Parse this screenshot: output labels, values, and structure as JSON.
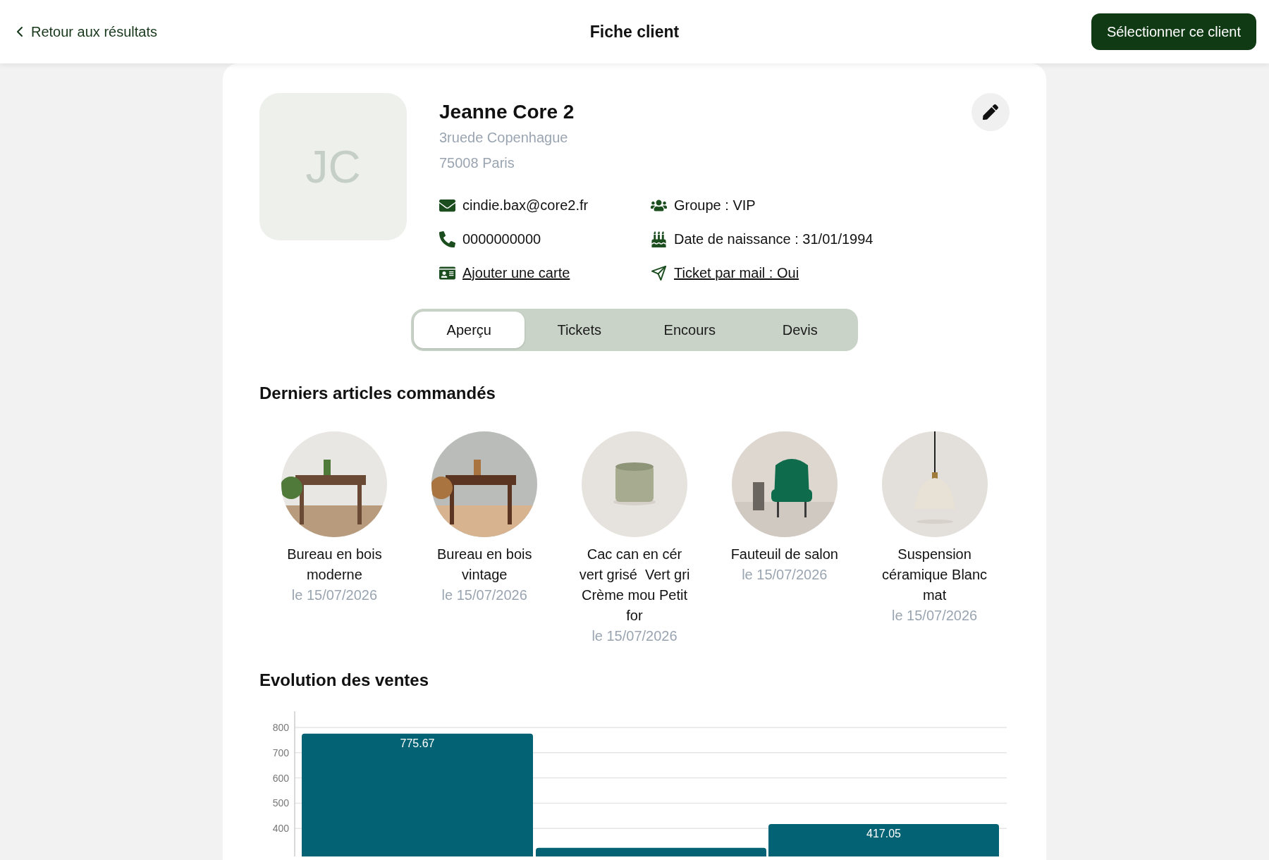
{
  "header": {
    "back_link": "Retour aux résultats",
    "title": "Fiche client",
    "action_button": "Sélectionner ce client"
  },
  "client": {
    "initials": "JC",
    "name": "Jeanne Core 2",
    "address_lines": [
      "3ruede Copenhague",
      "75008 Paris"
    ],
    "details": [
      {
        "kind": "email",
        "text": "cindie.bax@core2.fr",
        "link": false
      },
      {
        "kind": "group",
        "text": "Groupe : VIP",
        "link": false
      },
      {
        "kind": "phone",
        "text": "0000000000",
        "link": false
      },
      {
        "kind": "birthday",
        "text": "Date de naissance : 31/01/1994",
        "link": false
      },
      {
        "kind": "card",
        "text": "Ajouter une carte",
        "link": true
      },
      {
        "kind": "send",
        "text": "Ticket par mail : Oui",
        "link": true
      }
    ]
  },
  "tabs": [
    {
      "label": "Aperçu",
      "selected": true
    },
    {
      "label": "Tickets",
      "selected": false
    },
    {
      "label": "Encours",
      "selected": false
    },
    {
      "label": "Devis",
      "selected": false
    }
  ],
  "recent_items": {
    "title": "Derniers articles commandés",
    "items": [
      {
        "name": "Bureau en bois moderne",
        "date": "le 15/07/2026"
      },
      {
        "name": "Bureau en bois vintage",
        "date": "le 15/07/2026"
      },
      {
        "name": "Cac can en cér vert grisé  Vert gri Crème mou Petit for",
        "date": "le 15/07/2026"
      },
      {
        "name": "Fauteuil de salon",
        "date": "le 15/07/2026"
      },
      {
        "name": "Suspension céramique Blanc mat",
        "date": "le 15/07/2026"
      }
    ]
  },
  "sales": {
    "title": "Evolution des ventes",
    "chart_data": {
      "type": "bar",
      "series": [
        {
          "color": "#046275",
          "values": [
            775.67,
            323,
            417.05
          ]
        }
      ],
      "value_labels": [
        "775.67",
        null,
        "417.05"
      ],
      "ylim": [
        289,
        864
      ],
      "yticks": [
        400,
        500,
        600,
        700,
        800
      ],
      "grid": true
    }
  }
}
